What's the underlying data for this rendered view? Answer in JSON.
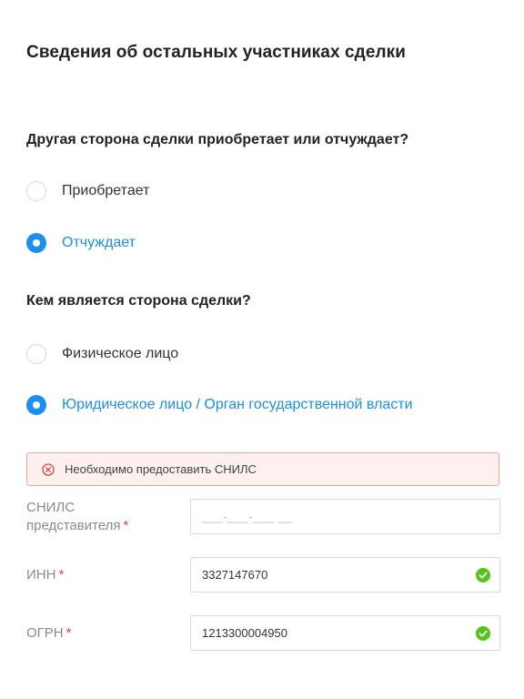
{
  "page": {
    "title": "Сведения об остальных участниках сделки"
  },
  "q1": {
    "question": "Другая сторона сделки приобретает или отчуждает?",
    "options": [
      {
        "label": "Приобретает",
        "selected": false
      },
      {
        "label": "Отчуждает",
        "selected": true
      }
    ]
  },
  "q2": {
    "question": "Кем является сторона сделки?",
    "options": [
      {
        "label": "Физическое лицо",
        "selected": false
      },
      {
        "label": "Юридическое лицо / Орган государственной власти",
        "selected": true
      }
    ]
  },
  "alert": {
    "text": "Необходимо предоставить СНИЛС",
    "icon": "error-circle-x-icon",
    "color": "#e2453c"
  },
  "fields": {
    "snils": {
      "label_line1": "СНИЛС",
      "label_line2": "представителя",
      "required_mark": "*",
      "placeholder": "___-___-___ __",
      "value": ""
    },
    "inn": {
      "label": "ИНН",
      "required_mark": "*",
      "value": "3327147670",
      "status_icon": "valid-check-icon"
    },
    "ogrn": {
      "label": "ОГРН",
      "required_mark": "*",
      "value": "1213300004950",
      "status_icon": "valid-check-icon"
    }
  },
  "colors": {
    "accent": "#1b8ff0",
    "error": "#e2453c",
    "error_bg": "#fdf0ef",
    "valid": "#52c41a"
  }
}
